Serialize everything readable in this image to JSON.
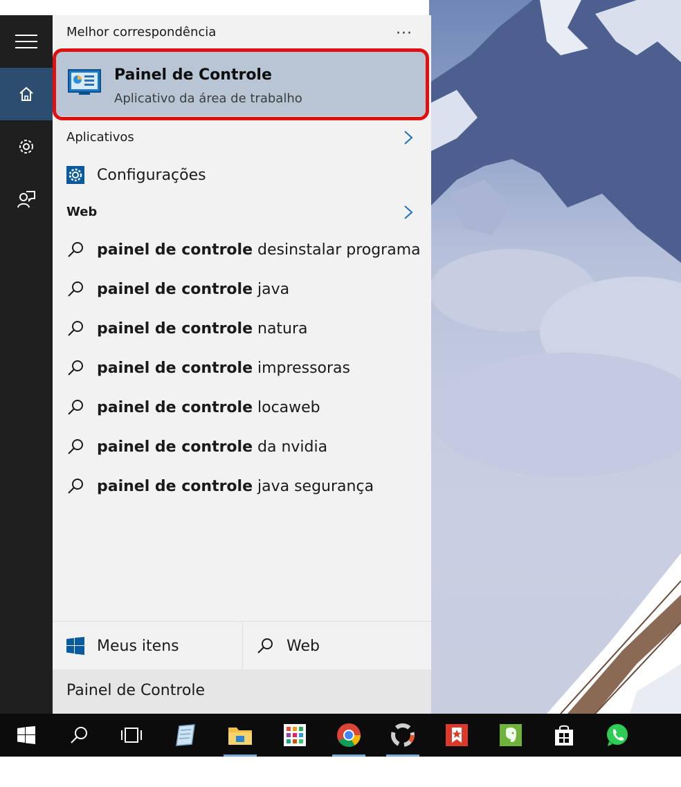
{
  "panel": {
    "best_match_heading": "Melhor correspondência",
    "more_label": "···",
    "best_match": {
      "title": "Painel de Controle",
      "subtitle": "Aplicativo da área de trabalho",
      "icon": "control-panel-icon"
    },
    "apps_heading": "Aplicativos",
    "apps": [
      {
        "label": "Configurações",
        "icon": "settings-gear-icon"
      }
    ],
    "web_heading": "Web",
    "web_suggestions": [
      {
        "bold": "painel de controle",
        "rest": " desinstalar programa"
      },
      {
        "bold": "painel de controle",
        "rest": " java"
      },
      {
        "bold": "painel de controle",
        "rest": " natura"
      },
      {
        "bold": "painel de controle",
        "rest": " impressoras"
      },
      {
        "bold": "painel de controle",
        "rest": " locaweb"
      },
      {
        "bold": "painel de controle",
        "rest": " da nvidia"
      },
      {
        "bold": "painel de controle",
        "rest": " java segurança"
      }
    ],
    "filters": {
      "my_items": "Meus itens",
      "web": "Web"
    },
    "search_value": "Painel de Controle"
  },
  "rail": {
    "items": [
      "hamburger-icon",
      "home-icon",
      "gear-icon",
      "feedback-icon"
    ]
  },
  "taskbar": {
    "items": [
      "windows-start-icon",
      "search-icon",
      "task-view-icon",
      "notepad-icon",
      "file-explorer-icon",
      "app-grid-icon",
      "chrome-icon",
      "app-circle-icon",
      "bookmark-star-icon",
      "evernote-icon",
      "store-icon",
      "whatsapp-icon"
    ]
  },
  "colors": {
    "rail": "#1f1f1f",
    "rail_active": "#2c4d6f",
    "panel": "#f2f2f2",
    "best_match_bg": "#b7c5d4",
    "highlight_outline": "#e01010",
    "accent": "#0a5a9e"
  }
}
